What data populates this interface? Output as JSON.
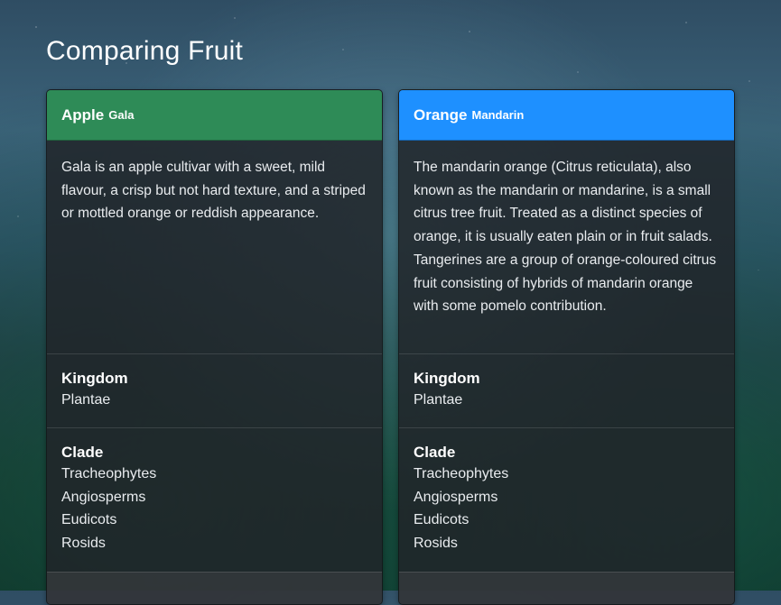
{
  "page": {
    "title": "Comparing Fruit"
  },
  "cards": [
    {
      "name": "Apple",
      "variety": "Gala",
      "header_color": "#2e8b57",
      "description": "Gala is an apple cultivar with a sweet, mild flavour, a crisp but not hard texture, and a striped or mottled orange or reddish appearance.",
      "kingdom": {
        "title": "Kingdom",
        "value": "Plantae"
      },
      "clade": {
        "title": "Clade",
        "values": [
          "Tracheophytes",
          "Angiosperms",
          "Eudicots",
          "Rosids"
        ]
      }
    },
    {
      "name": "Orange",
      "variety": "Mandarin",
      "header_color": "#1e90ff",
      "description": "The mandarin orange (Citrus reticulata), also known as the mandarin or mandarine, is a small citrus tree fruit. Treated as a distinct species of orange, it is usually eaten plain or in fruit salads. Tangerines are a group of orange-coloured citrus fruit consisting of hybrids of mandarin orange with some pomelo contribution.",
      "kingdom": {
        "title": "Kingdom",
        "value": "Plantae"
      },
      "clade": {
        "title": "Clade",
        "values": [
          "Tracheophytes",
          "Angiosperms",
          "Eudicots",
          "Rosids"
        ]
      }
    }
  ]
}
